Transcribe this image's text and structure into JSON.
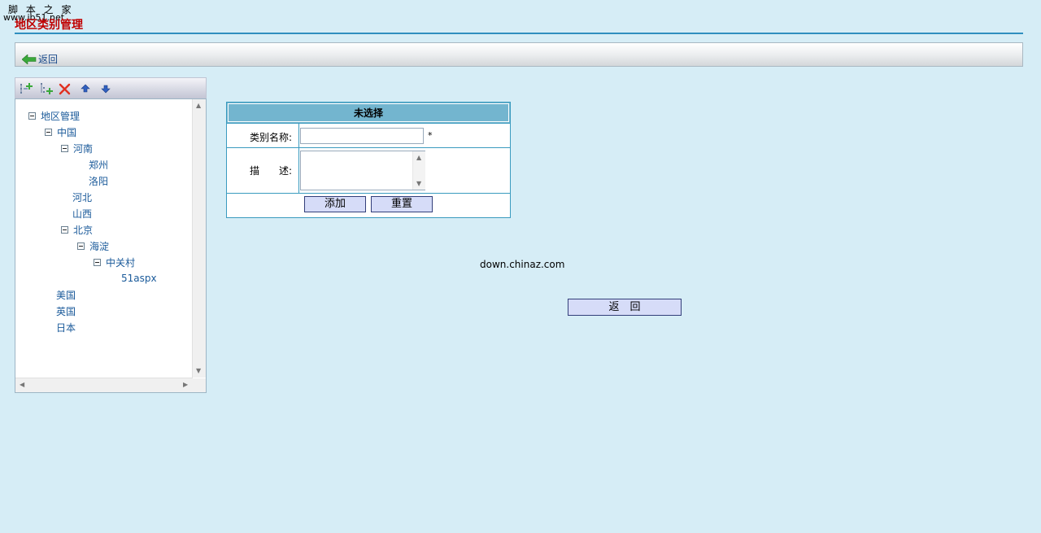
{
  "watermark": {
    "line1": "脚 本 之 家",
    "line2": "www.jb51.net"
  },
  "page_title": "地区类别管理",
  "backbar": {
    "back_label": "返回"
  },
  "toolbar": {
    "icons": [
      "add-node-icon",
      "add-child-icon",
      "delete-icon",
      "move-up-icon",
      "move-down-icon"
    ]
  },
  "tree": {
    "nodes": [
      {
        "label": "地区管理",
        "expanded": true
      },
      {
        "label": "中国",
        "expanded": true
      },
      {
        "label": "河南",
        "expanded": true
      },
      {
        "label": "郑州"
      },
      {
        "label": "洛阳"
      },
      {
        "label": "河北"
      },
      {
        "label": "山西"
      },
      {
        "label": "北京",
        "expanded": true
      },
      {
        "label": "海淀",
        "expanded": true
      },
      {
        "label": "中关村",
        "expanded": true
      },
      {
        "label": "51aspx"
      },
      {
        "label": "美国"
      },
      {
        "label": "英国"
      },
      {
        "label": "日本"
      }
    ]
  },
  "form": {
    "header": "未选择",
    "name_label": "类别名称:",
    "name_value": "",
    "required_mark": "*",
    "desc_label": "描　　述:",
    "desc_value": "",
    "add_button": "添加",
    "reset_button": "重置"
  },
  "footer": {
    "text": "down.chinaz.com",
    "back_button": "返　回"
  },
  "colors": {
    "background": "#d6edf6",
    "title": "#c00000",
    "accent_border": "#3a9bbf",
    "header_fill": "#73b5cf",
    "button_fill": "#d6dcf8",
    "link": "#1a5a9a"
  }
}
